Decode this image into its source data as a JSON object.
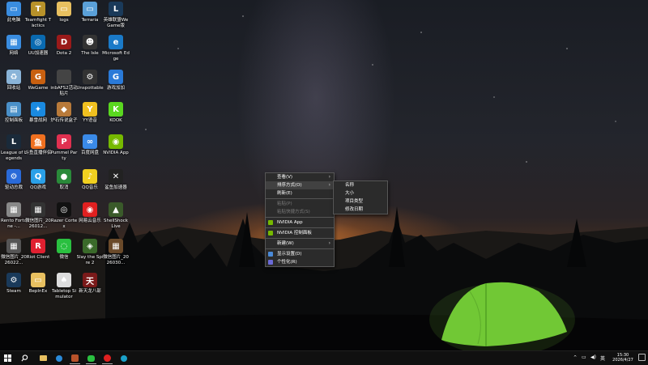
{
  "desktop": {
    "icons": [
      {
        "label": "此电脑",
        "icon": "computer-icon",
        "color": "#3a8de0",
        "glyph": "▭"
      },
      {
        "label": "Teamfight Tactics",
        "icon": "tft-icon",
        "color": "#b8922a",
        "glyph": "T"
      },
      {
        "label": "logs",
        "icon": "folder-icon",
        "color": "#e8c060",
        "glyph": "▭"
      },
      {
        "label": "Terraria",
        "icon": "terraria-icon",
        "color": "#5aa0d8",
        "glyph": "▭"
      },
      {
        "label": "英雄联盟WeGame版",
        "icon": "lol-icon",
        "color": "#1a3a5a",
        "glyph": "L"
      },
      {
        "label": "网络",
        "icon": "network-icon",
        "color": "#3a8de0",
        "glyph": "▦"
      },
      {
        "label": "UU加速器",
        "icon": "uu-icon",
        "color": "#0a6ab0",
        "glyph": "◎"
      },
      {
        "label": "Dota 2",
        "icon": "dota-icon",
        "color": "#9a1a1a",
        "glyph": "D"
      },
      {
        "label": "The Isle",
        "icon": "the-isle-icon",
        "color": "#333",
        "glyph": "☻"
      },
      {
        "label": "Microsoft Edge",
        "icon": "edge-icon",
        "color": "#1a7ac8",
        "glyph": "e"
      },
      {
        "label": "回收站",
        "icon": "recycle-bin-icon",
        "color": "#8ab4d8",
        "glyph": "♻"
      },
      {
        "label": "WeGame",
        "icon": "wegame-icon",
        "color": "#c86010",
        "glyph": "G"
      },
      {
        "label": "inbAFS2活动贴片",
        "icon": "file-icon",
        "color": "#444",
        "glyph": ""
      },
      {
        "label": "Unspottable",
        "icon": "unspottable-icon",
        "color": "#333",
        "glyph": "⚙"
      },
      {
        "label": "游戏加加",
        "icon": "game-plus-icon",
        "color": "#2a7ad8",
        "glyph": "G"
      },
      {
        "label": "控制面板",
        "icon": "control-panel-icon",
        "color": "#4a90c8",
        "glyph": "▤"
      },
      {
        "label": "暴雪战网",
        "icon": "battlenet-icon",
        "color": "#1a8ae0",
        "glyph": "✦"
      },
      {
        "label": "炉石传说盒子",
        "icon": "hearthstone-box-icon",
        "color": "#b87a3a",
        "glyph": "◆"
      },
      {
        "label": "YY语音",
        "icon": "yy-icon",
        "color": "#f0c020",
        "glyph": "Y"
      },
      {
        "label": "KOOK",
        "icon": "kook-icon",
        "color": "#5ad820",
        "glyph": "K"
      },
      {
        "label": "League of Legends",
        "icon": "league-icon",
        "color": "#1a2a3a",
        "glyph": "L"
      },
      {
        "label": "斗鱼直播伴侣",
        "icon": "douyu-icon",
        "color": "#f07020",
        "glyph": "鱼"
      },
      {
        "label": "Pummel Party",
        "icon": "pummel-party-icon",
        "color": "#e03050",
        "glyph": "P"
      },
      {
        "label": "百度网盘",
        "icon": "baidu-netdisk-icon",
        "color": "#3a8ae8",
        "glyph": "∞"
      },
      {
        "label": "NVIDIA App",
        "icon": "nvidia-app-icon",
        "color": "#76b900",
        "glyph": "◉"
      },
      {
        "label": "驱动总裁",
        "icon": "driver-icon",
        "color": "#2a6ad8",
        "glyph": "⚙"
      },
      {
        "label": "QQ游戏",
        "icon": "qq-game-icon",
        "color": "#2aa0e8",
        "glyph": "Q"
      },
      {
        "label": "取消",
        "icon": "globe-icon",
        "color": "#2a8a3a",
        "glyph": "●"
      },
      {
        "label": "QQ音乐",
        "icon": "qq-music-icon",
        "color": "#f0d020",
        "glyph": "♪"
      },
      {
        "label": "鲨鱼加速器",
        "icon": "shark-accelerator-icon",
        "color": "#222",
        "glyph": "✕"
      },
      {
        "label": "Rento Fortune -...",
        "icon": "rento-icon",
        "color": "#888",
        "glyph": "▦"
      },
      {
        "label": "微信图片_2026012...",
        "icon": "image-icon",
        "color": "#333",
        "glyph": "▦"
      },
      {
        "label": "Razer Cortex",
        "icon": "razer-icon",
        "color": "#111",
        "glyph": "◎"
      },
      {
        "label": "网易云音乐",
        "icon": "netease-music-icon",
        "color": "#e02020",
        "glyph": "◉"
      },
      {
        "label": "ShellShock Live",
        "icon": "shellshock-icon",
        "color": "#3a5a2a",
        "glyph": "▲"
      },
      {
        "label": "微信图片_2026022...",
        "icon": "image-icon",
        "color": "#555",
        "glyph": "▦"
      },
      {
        "label": "Riot Client",
        "icon": "riot-icon",
        "color": "#e02030",
        "glyph": "R"
      },
      {
        "label": "微信",
        "icon": "wechat-icon",
        "color": "#2ac040",
        "glyph": "◌"
      },
      {
        "label": "Slay the Spire 2",
        "icon": "slay-spire-icon",
        "color": "#3a6a2a",
        "glyph": "◈"
      },
      {
        "label": "微信图片_2026030...",
        "icon": "image-icon",
        "color": "#6a4a2a",
        "glyph": "▦"
      },
      {
        "label": "Steam",
        "icon": "steam-icon",
        "color": "#1a3a5a",
        "glyph": "⚙"
      },
      {
        "label": "BepInEx",
        "icon": "folder-icon",
        "color": "#e8c060",
        "glyph": "▭"
      },
      {
        "label": "Tabletop Simulator",
        "icon": "tabletop-icon",
        "color": "#ddd",
        "glyph": "♠"
      },
      {
        "label": "新天龙八部",
        "icon": "tianlong-icon",
        "color": "#7a1a1a",
        "glyph": "天"
      }
    ]
  },
  "context_menu": {
    "items": [
      {
        "label": "查看(V)",
        "submenu": true
      },
      {
        "label": "排序方式(O)",
        "submenu": true,
        "highlight": true
      },
      {
        "label": "刷新(E)"
      },
      {
        "sep": true
      },
      {
        "label": "粘贴(P)",
        "disabled": true
      },
      {
        "label": "粘贴快捷方式(S)",
        "disabled": true
      },
      {
        "sep": true
      },
      {
        "label": "NVIDIA App",
        "icon": "nvidia-icon"
      },
      {
        "sep": true
      },
      {
        "label": "NVIDIA 控制面板",
        "icon": "nvidia-icon"
      },
      {
        "sep": true
      },
      {
        "label": "新建(W)",
        "submenu": true
      },
      {
        "sep": true
      },
      {
        "label": "显示设置(D)",
        "icon": "display-icon"
      },
      {
        "label": "个性化(R)",
        "icon": "personalize-icon"
      }
    ],
    "submenu": [
      "名称",
      "大小",
      "项目类型",
      "修改日期"
    ]
  },
  "taskbar": {
    "tray": {
      "language": "英",
      "time": "15:30",
      "date": "2026/4/27"
    }
  },
  "colors": {
    "nvidia": "#76b900",
    "menu_bg": "#2b2b2b",
    "tent": "#7ad83a"
  }
}
